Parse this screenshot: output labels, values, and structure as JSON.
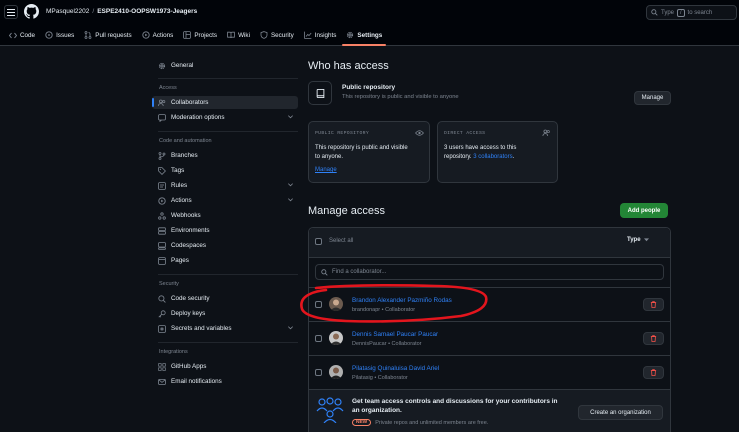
{
  "header": {
    "owner": "MPasquel2202",
    "separator": "/",
    "repo": "ESPE2410-OOPSW1973-Jeagers",
    "search_placeholder_prefix": "Type",
    "search_key": "/",
    "search_placeholder_suffix": "to search"
  },
  "tabs": [
    {
      "label": "Code",
      "icon": "code-icon"
    },
    {
      "label": "Issues",
      "icon": "issue-icon"
    },
    {
      "label": "Pull requests",
      "icon": "pull-request-icon"
    },
    {
      "label": "Actions",
      "icon": "play-icon"
    },
    {
      "label": "Projects",
      "icon": "table-icon"
    },
    {
      "label": "Wiki",
      "icon": "book-icon"
    },
    {
      "label": "Security",
      "icon": "shield-icon"
    },
    {
      "label": "Insights",
      "icon": "graph-icon"
    },
    {
      "label": "Settings",
      "icon": "gear-icon",
      "active": true
    }
  ],
  "sidebar": {
    "general": "General",
    "access_heading": "Access",
    "collaborators": "Collaborators",
    "moderation": "Moderation options",
    "code_heading": "Code and automation",
    "branches": "Branches",
    "tags": "Tags",
    "rules": "Rules",
    "actions": "Actions",
    "webhooks": "Webhooks",
    "environments": "Environments",
    "codespaces": "Codespaces",
    "pages": "Pages",
    "security_heading": "Security",
    "code_security": "Code security",
    "deploy_keys": "Deploy keys",
    "secrets": "Secrets and variables",
    "integrations_heading": "Integrations",
    "github_apps": "GitHub Apps",
    "email_notifications": "Email notifications"
  },
  "who_has_access": {
    "title": "Who has access",
    "visibility_title": "Public repository",
    "visibility_desc": "This repository is public and visible to anyone",
    "manage_button": "Manage",
    "public_card": {
      "label": "PUBLIC REPOSITORY",
      "text_line1": "This repository is public and visible",
      "text_line2": "to anyone.",
      "link": "Manage"
    },
    "direct_card": {
      "label": "DIRECT ACCESS",
      "text_line1": "3 users have access to this",
      "text_prefix": "repository.",
      "link": "3 collaborators",
      "text_suffix": "."
    }
  },
  "manage_access": {
    "title": "Manage access",
    "add_button": "Add people",
    "select_all": "Select all",
    "type_filter": "Type",
    "find_placeholder": "Find a collaborator...",
    "collaborators": [
      {
        "name": "Brandon Alexander Pazmiño Rodas",
        "username": "brandonapr",
        "role": "Collaborator"
      },
      {
        "name": "Dennis Samael Paucar Paucar",
        "username": "DennisPaucar",
        "role": "Collaborator"
      },
      {
        "name": "Pilatasig Quinaluisa David Ariel",
        "username": "Pilatasig",
        "role": "Collaborator"
      }
    ],
    "role_separator": "•"
  },
  "org_banner": {
    "title_line1": "Get team access controls and discussions for your contributors in",
    "title_line2": "an organization.",
    "badge": "NEW",
    "subtitle": "Private repos and unlimited members are free.",
    "button": "Create an organization"
  },
  "colors": {
    "accent_blue": "#2f81f7",
    "green": "#238636",
    "annotation_red": "#e3151d",
    "danger": "#f85149"
  }
}
